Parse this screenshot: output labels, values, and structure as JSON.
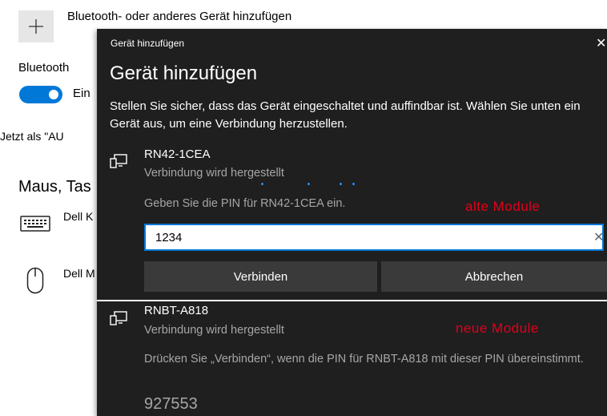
{
  "settings": {
    "add_device_label": "Bluetooth- oder anderes Gerät hinzufügen",
    "bluetooth_label": "Bluetooth",
    "toggle_state": "Ein",
    "discoverable_text": "Jetzt als \"AU",
    "section_title": "Maus, Tas",
    "keyboard_name": "Dell K",
    "mouse_name": "Dell M"
  },
  "dialog": {
    "titlebar": "Gerät hinzufügen",
    "close_glyph": "✕",
    "heading": "Gerät hinzufügen",
    "description": "Stellen Sie sicher, dass das Gerät eingeschaltet und auffindbar ist. Wählen Sie unten ein Gerät aus, um eine Verbindung herzustellen.",
    "device1": {
      "name": "RN42-1CEA",
      "status": "Verbindung wird hergestellt",
      "pin_hint": "Geben Sie die PIN für RN42-1CEA ein.",
      "pin_value": "1234",
      "clear_glyph": "✕",
      "connect_label": "Verbinden",
      "cancel_label": "Abbrechen"
    },
    "device2": {
      "name": "RNBT-A818",
      "status": "Verbindung wird hergestellt",
      "description": "Drücken Sie „Verbinden“, wenn die PIN für RNBT-A818 mit dieser PIN übereinstimmt.",
      "pin_code": "927553"
    }
  },
  "annotations": {
    "old": "alte Module",
    "new": "neue Module"
  },
  "icons": {
    "add": "plus-icon",
    "keyboard": "keyboard-icon",
    "mouse": "mouse-icon",
    "device": "device-icon"
  },
  "colors": {
    "accent": "#0078d7",
    "dialog_bg": "#1f1f1f",
    "button_bg": "#3a3a3a",
    "annotation": "#e3001b",
    "secondary_text": "#a6a6a6"
  }
}
